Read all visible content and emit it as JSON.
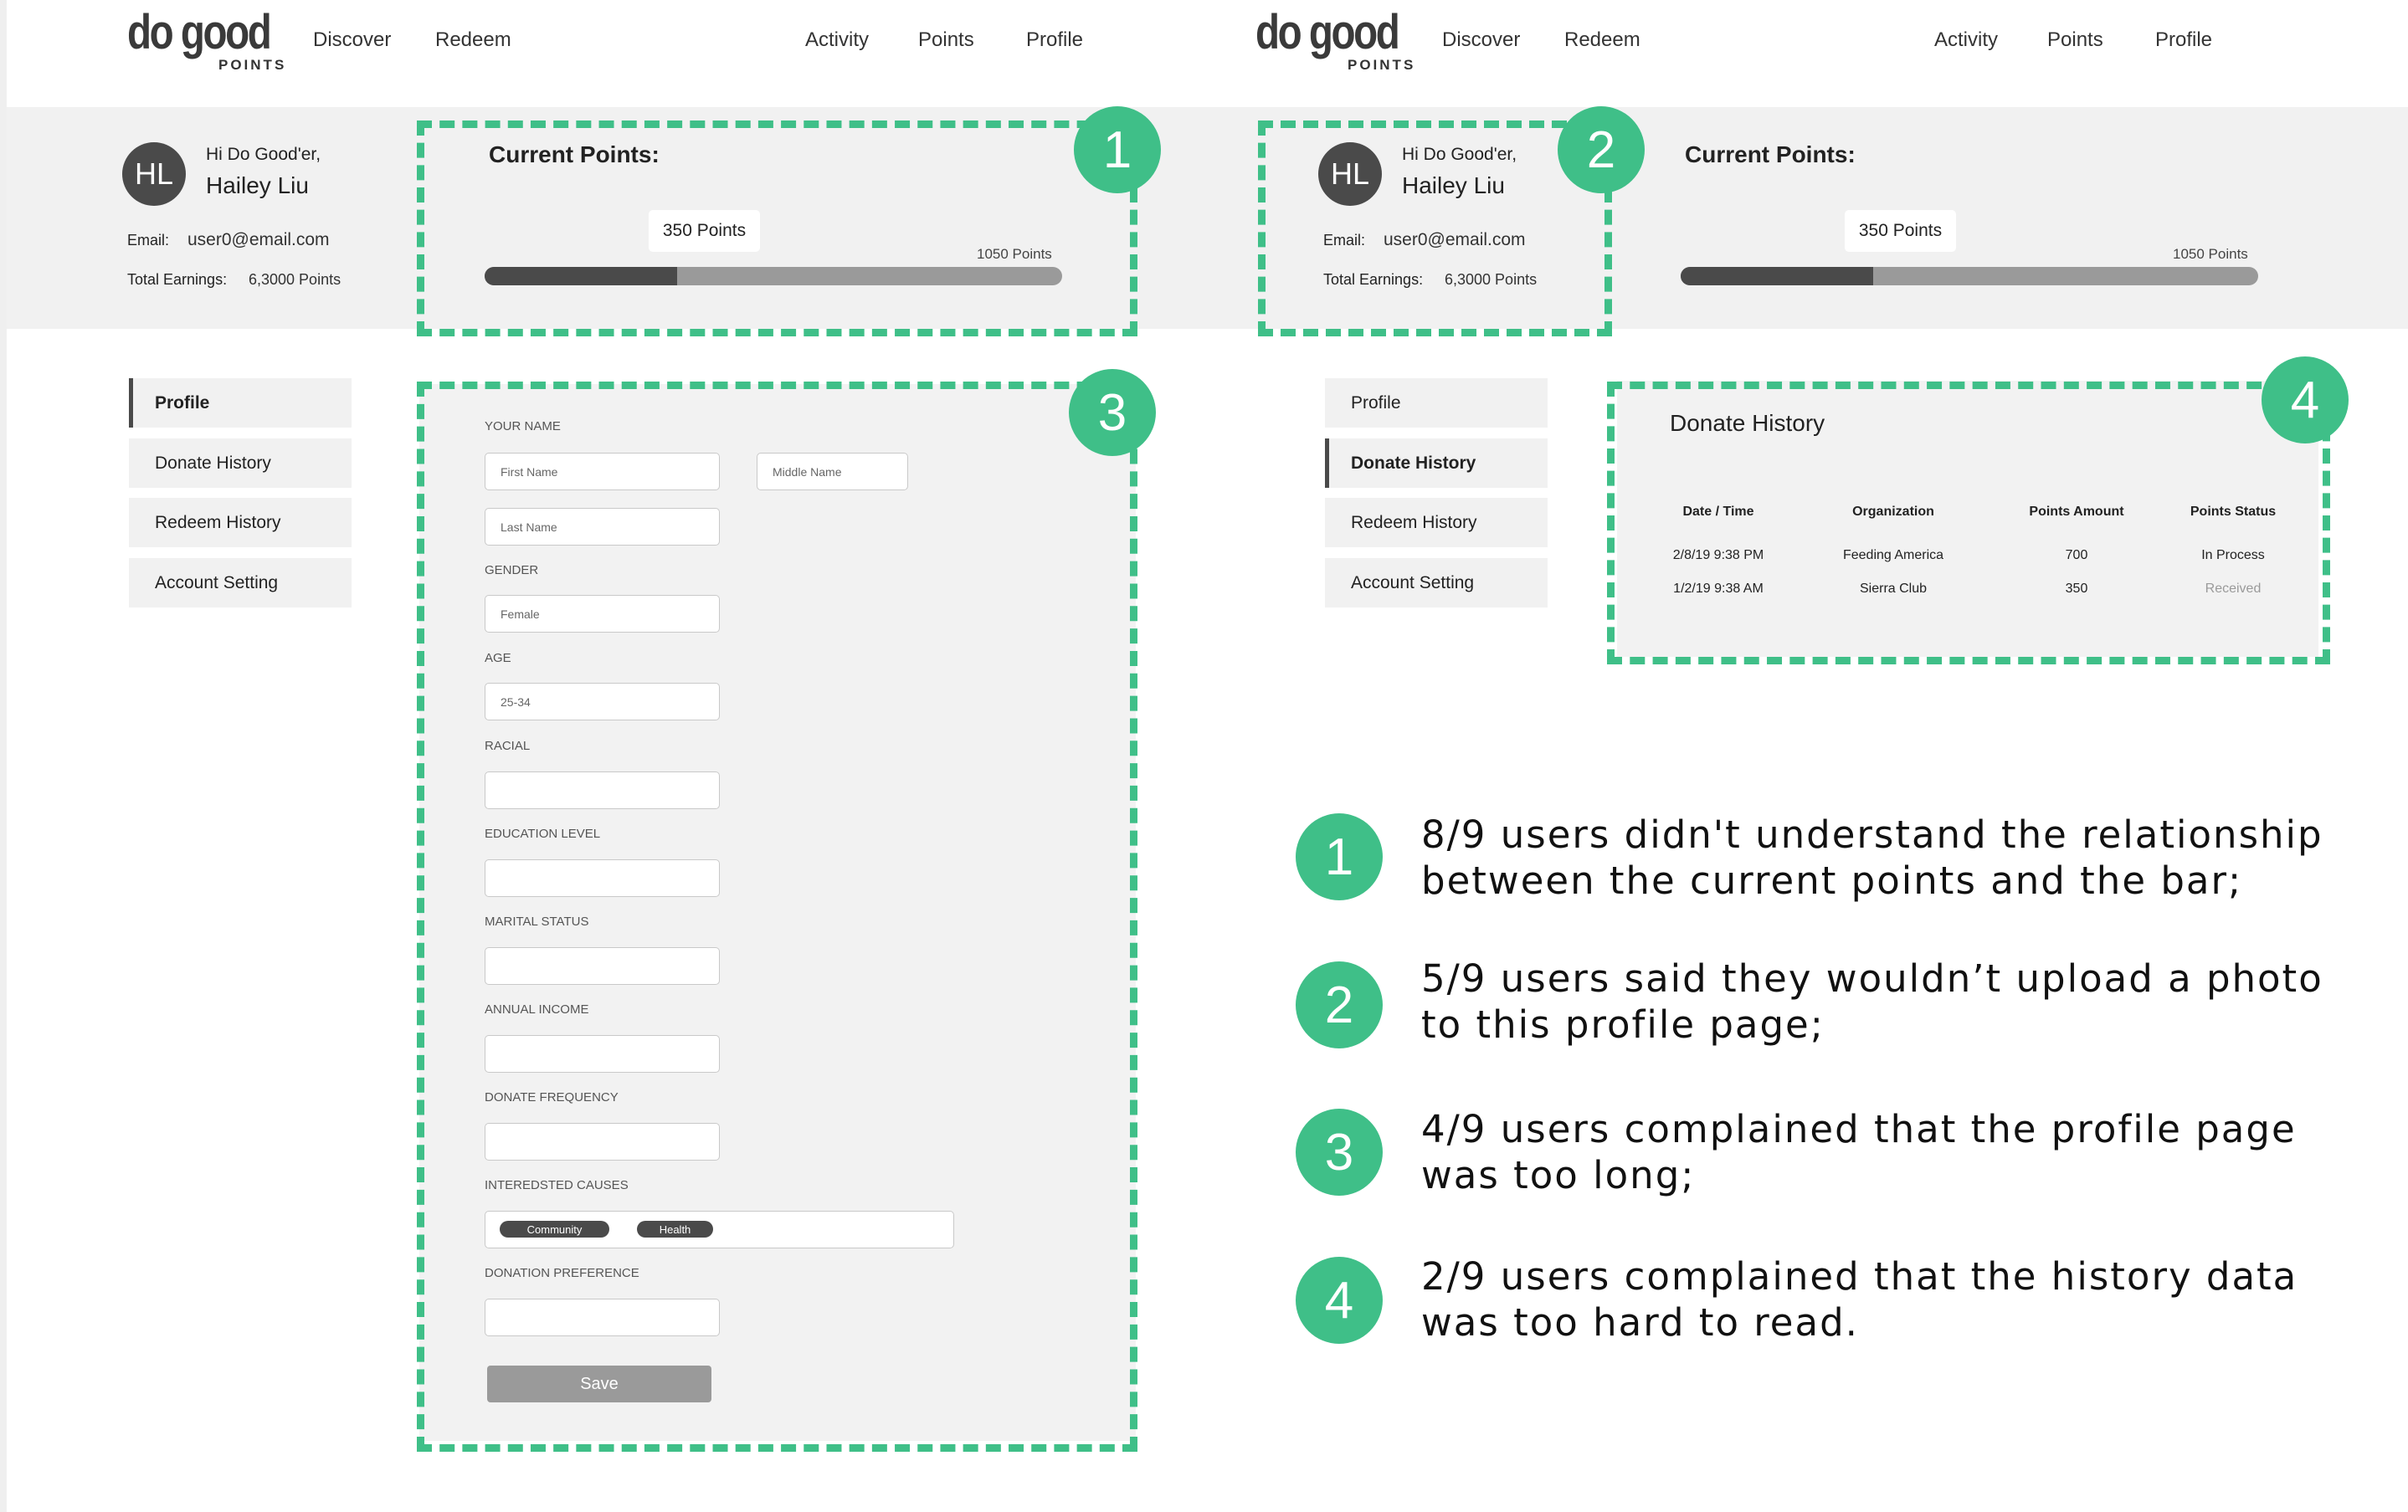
{
  "brand": {
    "logo_main": "do good",
    "logo_sub": "POINTS"
  },
  "nav": {
    "discover": "Discover",
    "redeem": "Redeem",
    "activity": "Activity",
    "points": "Points",
    "profile": "Profile"
  },
  "user": {
    "greeting": "Hi Do Good'er,",
    "name": "Hailey Liu",
    "initials": "HL",
    "email_label": "Email:",
    "email": "user0@email.com",
    "earnings_label": "Total Earnings:",
    "earnings": "6,3000 Points"
  },
  "points": {
    "title": "Current Points:",
    "current_label": "350 Points",
    "max_label": "1050 Points",
    "current": 350,
    "max": 1050
  },
  "sidebar": {
    "items": [
      {
        "label": "Profile"
      },
      {
        "label": "Donate History"
      },
      {
        "label": "Redeem History"
      },
      {
        "label": "Account Setting"
      }
    ]
  },
  "form": {
    "your_name": "YOUR NAME",
    "first_name": "First Name",
    "middle_name": "Middle Name",
    "last_name": "Last Name",
    "gender_label": "GENDER",
    "gender_value": "Female",
    "age_label": "AGE",
    "age_value": "25-34",
    "racial_label": "RACIAL",
    "education_label": "EDUCATION LEVEL",
    "marital_label": "MARITAL STATUS",
    "income_label": "ANNUAL INCOME",
    "frequency_label": "DONATE FREQUENCY",
    "causes_label": "INTEREDSTED CAUSES",
    "causes": [
      "Community",
      "Health"
    ],
    "preference_label": "DONATION PREFERENCE",
    "save_label": "Save"
  },
  "donate_history": {
    "title": "Donate History",
    "columns": [
      "Date / Time",
      "Organization",
      "Points Amount",
      "Points Status"
    ],
    "rows": [
      [
        "2/8/19 9:38 PM",
        "Feeding America",
        "700",
        "In Process"
      ],
      [
        "1/2/19 9:38 AM",
        "Sierra Club",
        "350",
        "Received"
      ]
    ]
  },
  "badges": [
    "1",
    "2",
    "3",
    "4"
  ],
  "findings": [
    {
      "num": "1",
      "line1": "8/9 users didn't understand the relationship",
      "line2": "between the current points and the bar;"
    },
    {
      "num": "2",
      "line1": "5/9 users said they wouldn’t upload a photo",
      "line2": "to this profile page;"
    },
    {
      "num": "3",
      "line1": "4/9 users complained that the profile page",
      "line2": "was too long;"
    },
    {
      "num": "4",
      "line1": "2/9 users complained that the history data",
      "line2": "was too hard to read."
    }
  ],
  "colors": {
    "accent": "#3fbf88",
    "dark": "#4a4a4a",
    "panel": "#f1f1f1"
  }
}
